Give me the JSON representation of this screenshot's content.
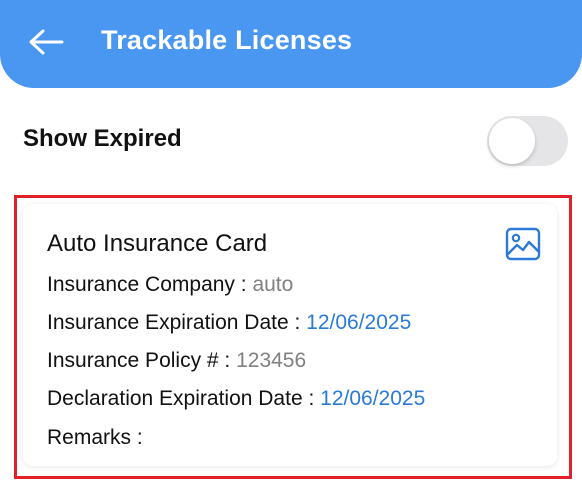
{
  "header": {
    "title": "Trackable Licenses",
    "back_icon": "arrow-left-icon",
    "background_color": "#4a97f2"
  },
  "filters": {
    "show_expired_label": "Show Expired",
    "show_expired_on": false
  },
  "card": {
    "title": "Auto Insurance Card",
    "image_icon": "image-icon",
    "highlight_color": "#e0202a",
    "fields": {
      "company_label": "Insurance Company : ",
      "company_value": "auto",
      "expiration_label": "Insurance Expiration Date : ",
      "expiration_value": "12/06/2025",
      "policy_label": "Insurance Policy # : ",
      "policy_value": "123456",
      "declaration_label": "Declaration Expiration Date : ",
      "declaration_value": "12/06/2025",
      "remarks_label": "Remarks : ",
      "remarks_value": ""
    },
    "date_color": "#2a7ad8"
  }
}
